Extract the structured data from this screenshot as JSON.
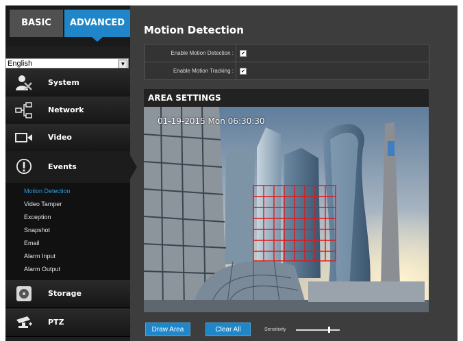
{
  "tabs": {
    "basic": "BASIC",
    "advanced": "ADVANCED"
  },
  "language": {
    "selected": "English"
  },
  "sidebar": {
    "items": [
      {
        "label": "System",
        "icon": "user-gear-icon"
      },
      {
        "label": "Network",
        "icon": "network-icon"
      },
      {
        "label": "Video",
        "icon": "camera-icon"
      },
      {
        "label": "Events",
        "icon": "alert-circle-icon"
      },
      {
        "label": "Storage",
        "icon": "disk-icon"
      },
      {
        "label": "PTZ",
        "icon": "ptz-camera-icon"
      }
    ],
    "events_submenu": [
      "Motion Detection",
      "Video Tamper",
      "Exception",
      "Snapshot",
      "Email",
      "Alarm Input",
      "Alarm Output"
    ],
    "active_submenu": "Motion Detection"
  },
  "page": {
    "title": "Motion Detection",
    "enable_motion_label": "Enable Motion Detection :",
    "enable_motion_checked": true,
    "enable_tracking_label": "Enable Motion Tracking :",
    "enable_tracking_checked": true,
    "area_settings": "AREA SETTINGS",
    "timestamp": "01-19-2015 Mon  06:30:30",
    "draw_area": "Draw Area",
    "clear_all": "Clear All",
    "sensitivity_label": "Sensitivity",
    "sensitivity_level": 0.75
  },
  "colors": {
    "accent": "#1f87c9",
    "active_submenu": "#2f9be0",
    "grid": "#e01818"
  }
}
